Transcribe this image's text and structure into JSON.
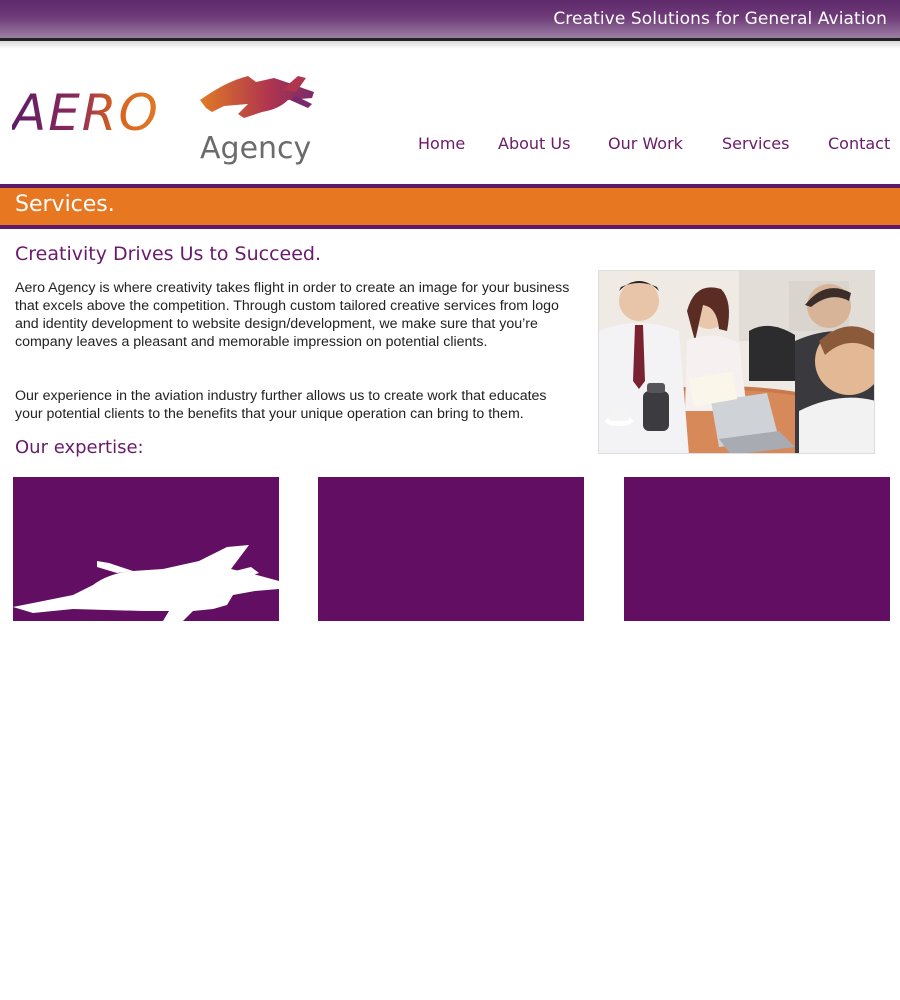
{
  "header": {
    "tagline": "Creative Solutions for General Aviation",
    "logo_text_primary": "AERO",
    "logo_text_secondary": "Agency"
  },
  "nav": {
    "items": [
      {
        "label": "Home"
      },
      {
        "label": "About Us"
      },
      {
        "label": "Our Work"
      },
      {
        "label": "Services"
      },
      {
        "label": "Contact"
      }
    ]
  },
  "section": {
    "title": "Services."
  },
  "main": {
    "headline": "Creativity Drives Us to Succeed.",
    "paragraph1": "Aero Agency is where creativity takes flight in order to create an image for your business that excels above the competition. Through custom tailored creative services from logo and identity development to website design/development, we make sure that you’re company leaves a pleasant and memorable impression on potential clients.",
    "paragraph2": "Our experience in the aviation industry further allows us to create work that educates your potential clients to the benefits that your unique operation can bring to them.",
    "expertise_heading": "Our expertise:",
    "photo_icon": "business-meeting-photo"
  },
  "expertise_cards": [
    {
      "icon": "airplane-silhouette-icon"
    },
    {
      "icon": ""
    },
    {
      "icon": ""
    }
  ],
  "colors": {
    "brand_purple": "#620f63",
    "accent_orange": "#e87722",
    "top_bar": "#5e2a6b"
  }
}
